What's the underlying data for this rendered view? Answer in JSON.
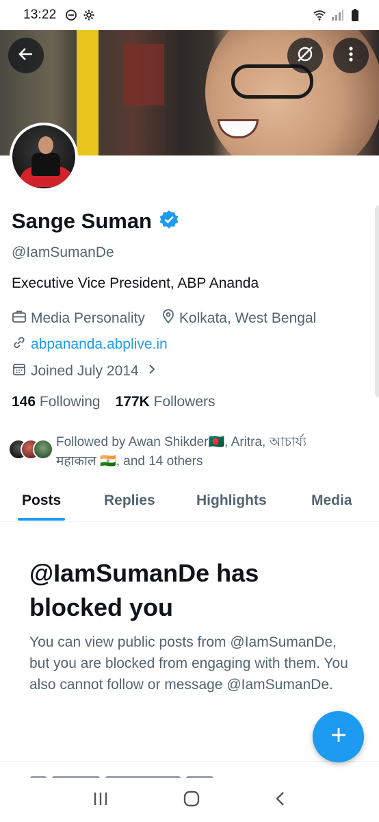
{
  "status_bar": {
    "time": "13:22"
  },
  "profile": {
    "name": "Sange Suman",
    "handle": "@IamSumanDe",
    "bio": "Executive Vice President, ABP Ananda",
    "category": "Media Personality",
    "location": "Kolkata, West Bengal",
    "website": "abpananda.abplive.in",
    "joined": "Joined July 2014",
    "following_count": "146",
    "following_label": "Following",
    "followers_count": "177K",
    "followers_label": "Followers"
  },
  "followed_by": {
    "line1": "Followed by Awan Shikder🇧🇩, Aritra, আচার্য্য",
    "line2": "महाकाल 🇮🇳, and 14 others"
  },
  "tabs": [
    {
      "label": "Posts",
      "active": true
    },
    {
      "label": "Replies",
      "active": false
    },
    {
      "label": "Highlights",
      "active": false
    },
    {
      "label": "Media",
      "active": false
    }
  ],
  "blocked": {
    "title": "@IamSumanDe has blocked you",
    "body": "You can view public posts from @IamSumanDe, but you are blocked from engaging with them. You also cannot follow or message @IamSumanDe."
  },
  "icons": {
    "back": "back-arrow-icon",
    "grok": "grok-icon",
    "more": "more-vertical-icon",
    "verified": "verified-badge-icon",
    "category": "briefcase-icon",
    "location": "location-pin-icon",
    "link": "link-icon",
    "calendar": "calendar-icon",
    "compose": "plus-icon"
  },
  "colors": {
    "accent": "#1d9bf0",
    "text_primary": "#0f1419",
    "text_secondary": "#536471"
  }
}
